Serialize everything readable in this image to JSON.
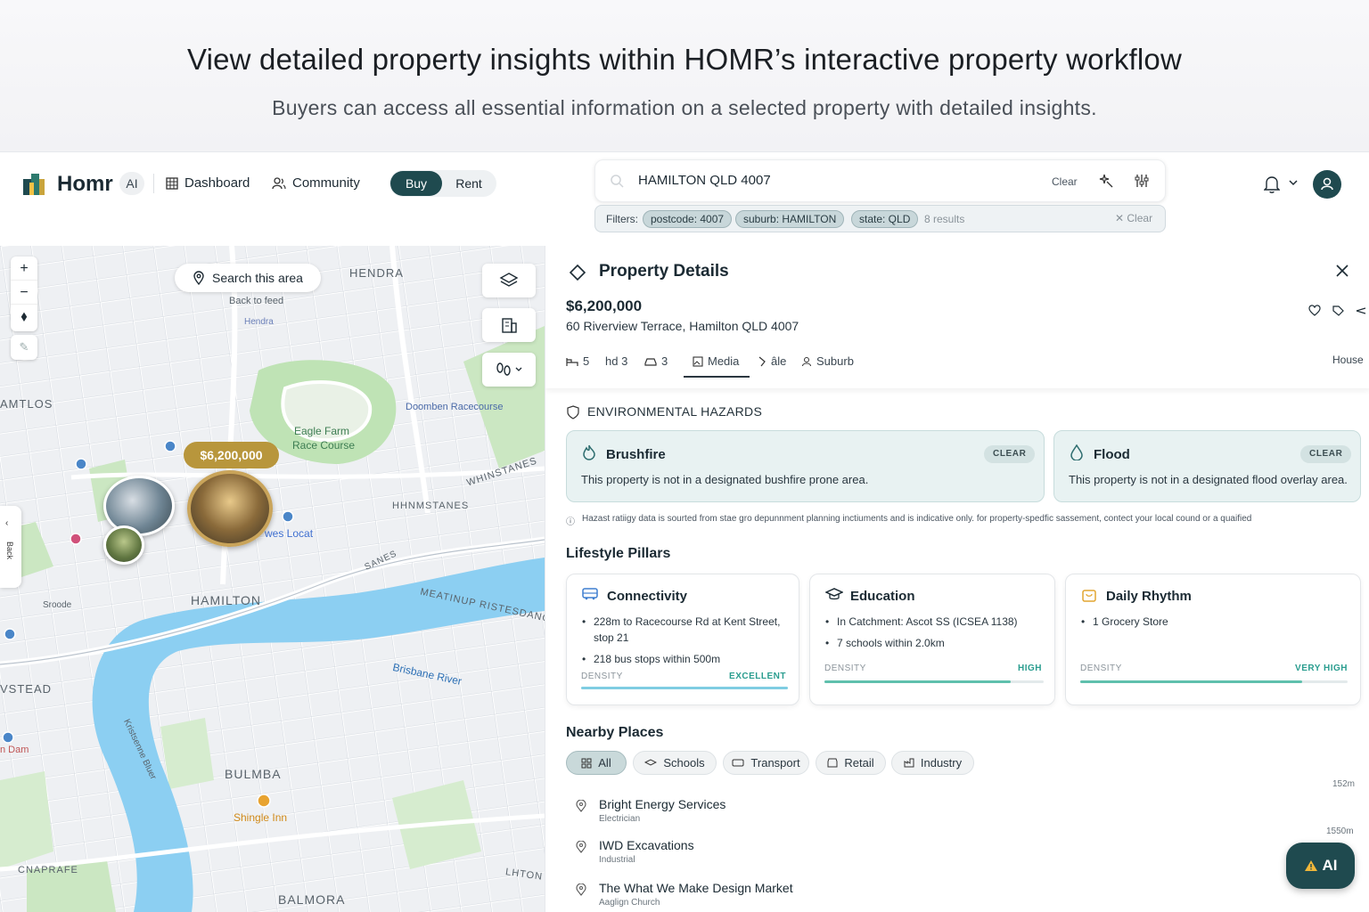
{
  "hero": {
    "title": "View detailed property insights within HOMR’s interactive property workflow",
    "subtitle": "Buyers can access all essential information on a selected property with detailed insights."
  },
  "appbar": {
    "brand": "Homr",
    "ai_chip": "AI",
    "nav": [
      "Dashboard",
      "Community"
    ],
    "toggle": {
      "active": "Buy",
      "inactive": "Rent"
    },
    "search": {
      "value": "HAMILTON QLD 4007",
      "clear_label": "Clear"
    },
    "filters": {
      "label": "Filters:",
      "chips": [
        "postcode: 4007",
        "suburb: HAMILTON",
        "state: QLD"
      ],
      "results": "8 results",
      "clear_label": "✕ Clear"
    }
  },
  "map": {
    "search_area_label": "Search this area",
    "zoom_in": "+",
    "zoom_out": "−",
    "price_pin": "$6,200,000",
    "labels": {
      "hendra": "HENDRA",
      "back_to_feed": "Back to feed",
      "hendra_small": "Hendra",
      "hamtlos": "AMTLOS",
      "doomben": "Doomben Racecourse",
      "eagle_farm": "Eagle Farm",
      "race_course": "Race Course",
      "whinstanes_1": "WHINSTANES",
      "whinstanes_2": "HHNMSTANES",
      "hamilton": "HAMILTON",
      "meatinup": "MEATINUP RISTESDANG",
      "sanes": "SANES",
      "wes_locat": "wes Locat",
      "sroode": "Sroode",
      "brisbane_river": "Brisbane River",
      "vstead": "VSTEAD",
      "n_dam": "n Dam",
      "kristenne": "Kristsenne Bluer",
      "bulmba": "BULMBA",
      "shingle_inn": "Shingle Inn",
      "cnaprafe": "CNAPRAFE",
      "lhton": "LHTON",
      "balmora": "BALMORA",
      "side_tab": "Back"
    }
  },
  "panel": {
    "title": "Property Details",
    "price": "$6,200,000",
    "address": "60 Riverview Terrace, Hamilton QLD 4007",
    "tabs": {
      "beds": "5",
      "baths": "hd 3",
      "cars": "3",
      "media": "Media",
      "sale": "âle",
      "suburb": "Suburb"
    },
    "property_type": "House",
    "hazards": {
      "heading": "ENVIRONMENTAL HAZARDS",
      "items": [
        {
          "title": "Brushfire",
          "badge": "CLEAR",
          "desc": "This property is not in a designated bushfire prone area."
        },
        {
          "title": "Flood",
          "badge": "CLEAR",
          "desc": "This property is not in a designated flood overlay area."
        }
      ],
      "disclaimer": "Hazast ratiigy data is sourted from stae gro depunnment planning inctiuments and is indicative only. for property-spedfic sassement, contect your local cound or a quaified"
    },
    "lifestyle": {
      "heading": "Lifestyle Pillars",
      "cards": [
        {
          "title": "Connectivity",
          "points": [
            "228m to Racecourse Rd at Kent Street, stop 21",
            "218 bus stops within 500m"
          ],
          "density_label": "DENSITY",
          "level": "EXCELLENT",
          "fill": 1.0
        },
        {
          "title": "Education",
          "points": [
            "In Catchment: Ascot SS (ICSEA 1138)",
            "7 schools within 2.0km"
          ],
          "density_label": "DENSITY",
          "level": "HIGH",
          "fill": 0.85
        },
        {
          "title": "Daily Rhythm",
          "points": [
            "1 Grocery Store"
          ],
          "density_label": "DENSITY",
          "level": "VERY HIGH",
          "fill": 0.83
        }
      ]
    },
    "nearby": {
      "heading": "Nearby Places",
      "chips": [
        "All",
        "Schools",
        "Transport",
        "Retail",
        "Industry"
      ],
      "places": [
        {
          "name": "Bright Energy Services",
          "category": "Electrician",
          "distance": "152m"
        },
        {
          "name": "IWD Excavations",
          "category": "Industrial",
          "distance": "1550m"
        },
        {
          "name": "The What We Make Design Market",
          "category": "Aaglign Church",
          "distance": ""
        }
      ]
    },
    "ai_button": "AI"
  },
  "colors": {
    "brand": "#1f4a4f",
    "accent_gold": "#b8963c",
    "clear_bg": "#e8f2f2",
    "density_fill": "#5fc0ad",
    "connectivity_fill": "#7fcde2"
  }
}
